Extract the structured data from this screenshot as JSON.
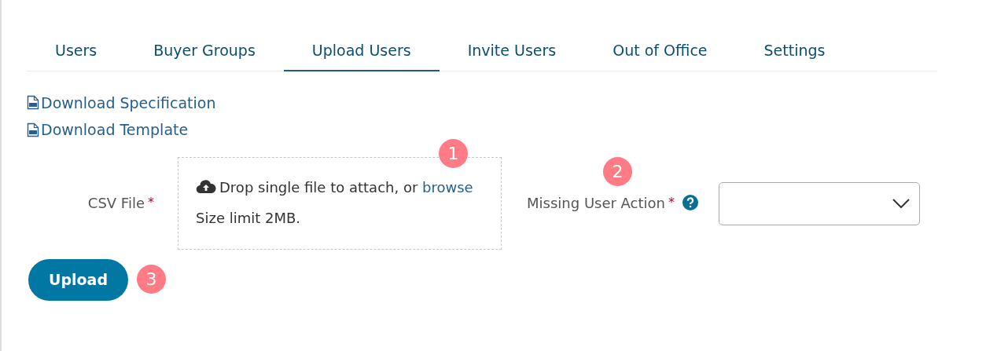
{
  "tabs": [
    {
      "label": "Users",
      "selected": false
    },
    {
      "label": "Buyer Groups",
      "selected": false
    },
    {
      "label": "Upload Users",
      "selected": true
    },
    {
      "label": "Invite Users",
      "selected": false
    },
    {
      "label": "Out of Office",
      "selected": false
    },
    {
      "label": "Settings",
      "selected": false
    }
  ],
  "downloads": [
    {
      "label": "Download Specification"
    },
    {
      "label": "Download Template"
    }
  ],
  "csv_file": {
    "label": "CSV File",
    "required_mark": "*",
    "drop_text": "Drop single file to attach, or",
    "browse_link": "browse",
    "size_limit": "Size limit 2MB."
  },
  "missing_user_action": {
    "label": "Missing User Action",
    "required_mark": "*",
    "help": true
  },
  "upload_button": "Upload",
  "callouts": [
    "1",
    "2",
    "3"
  ]
}
